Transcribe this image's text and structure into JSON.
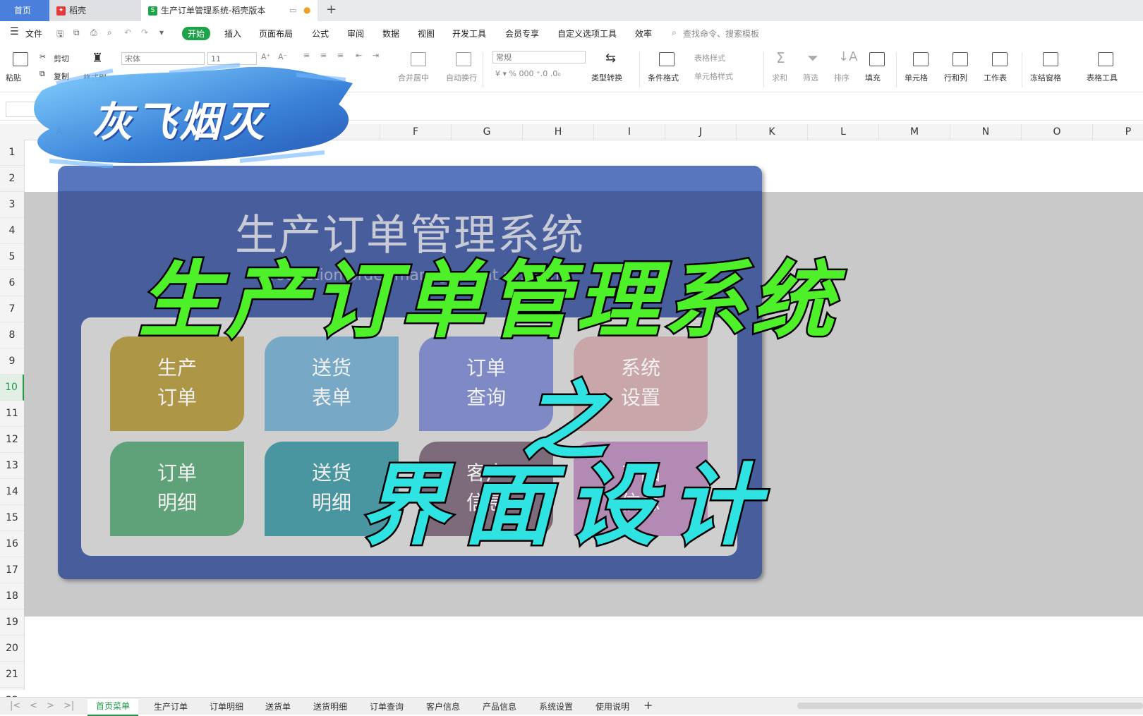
{
  "tabs": {
    "home": "首页",
    "daoke": "稻壳",
    "active": "生产订单管理系统-稻壳版本"
  },
  "menu": {
    "file": "文件",
    "items": [
      "开始",
      "插入",
      "页面布局",
      "公式",
      "审阅",
      "数据",
      "视图",
      "开发工具",
      "会员专享",
      "自定义选项工具",
      "效率"
    ],
    "search": "查找命令、搜索模板"
  },
  "ribbon": {
    "paste": "粘贴",
    "cut": "剪切",
    "copy": "复制",
    "format_painter": "格式刷",
    "font": "宋体",
    "font_size": "11",
    "merge": "合并居中",
    "wrap": "自动换行",
    "number_format": "常规",
    "type_convert": "类型转换",
    "cond_format": "条件格式",
    "table_style": "表格样式",
    "cell_style": "单元格样式",
    "sum": "求和",
    "filter": "筛选",
    "sort": "排序",
    "fill": "填充",
    "cell": "单元格",
    "rowcol": "行和列",
    "worksheet": "工作表",
    "freeze": "冻结窗格",
    "table_tools": "表格工具"
  },
  "columns": [
    "A",
    "",
    "",
    "",
    "",
    "F",
    "G",
    "H",
    "I",
    "J",
    "K",
    "L",
    "M",
    "N",
    "O",
    "P"
  ],
  "rows": [
    "1",
    "2",
    "3",
    "4",
    "5",
    "6",
    "7",
    "8",
    "9",
    "10",
    "11",
    "12",
    "13",
    "14",
    "15",
    "16",
    "17",
    "18",
    "19",
    "20",
    "21",
    "22"
  ],
  "selected_row": "10",
  "dashboard": {
    "title": "生产订单管理系统",
    "subtitle": "Production order management system",
    "cards": [
      {
        "line1": "生产",
        "line2": "订单",
        "color": "#ad9646"
      },
      {
        "line1": "送货",
        "line2": "表单",
        "color": "#77a9c6"
      },
      {
        "line1": "订单",
        "line2": "查询",
        "color": "#7e89c6"
      },
      {
        "line1": "系统",
        "line2": "设置",
        "color": "#c9a6aa"
      },
      {
        "line1": "订单",
        "line2": "明细",
        "color": "#5fa27a"
      },
      {
        "line1": "送货",
        "line2": "明细",
        "color": "#4a96a0"
      },
      {
        "line1": "客户",
        "line2": "信息",
        "color": "#7d6b7b"
      },
      {
        "line1": "产品",
        "line2": "信息",
        "color": "#b28ab4"
      }
    ]
  },
  "overlay": {
    "logo": "灰飞烟灭",
    "line1": "生产订单管理系统",
    "line2": "之",
    "line3": "界面设计"
  },
  "sheets": [
    "首页菜单",
    "生产订单",
    "订单明细",
    "送货单",
    "送货明细",
    "订单查询",
    "客户信息",
    "产品信息",
    "系统设置",
    "使用说明"
  ],
  "add_sheet": "+"
}
